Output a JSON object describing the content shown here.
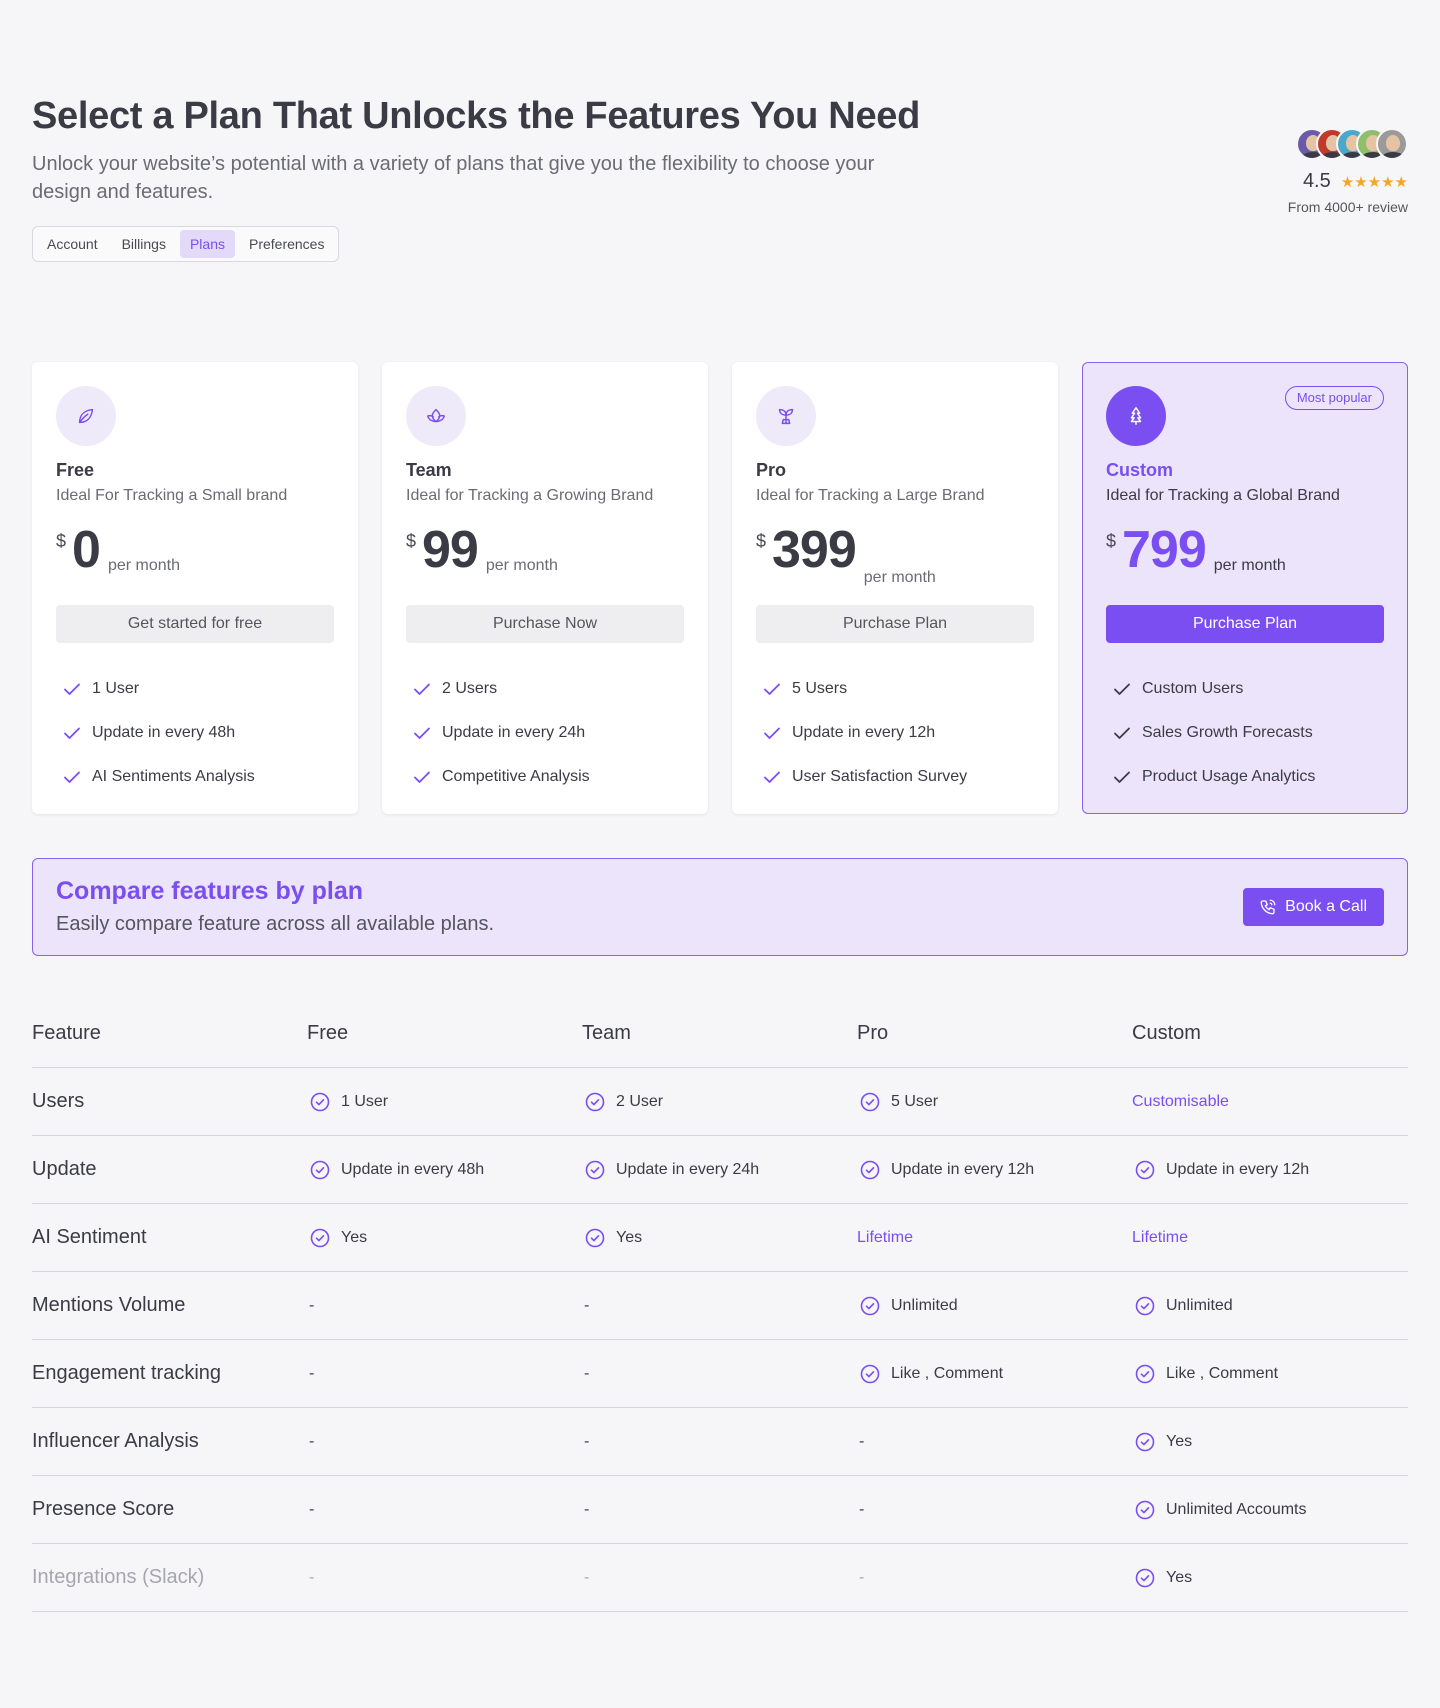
{
  "header": {
    "title": "Select a Plan That Unlocks the Features You Need",
    "subtitle": "Unlock your website’s potential with a variety of plans that give you the flexibility to choose your design and features.",
    "tabs": [
      {
        "label": "Account"
      },
      {
        "label": "Billings"
      },
      {
        "label": "Plans",
        "active": true
      },
      {
        "label": "Preferences"
      }
    ]
  },
  "rating": {
    "score": "4.5",
    "stars": "★★★★★",
    "reviews": "From 4000+ review",
    "avatar_colors": [
      "#6b5aa8",
      "#c0392b",
      "#4aa8c9",
      "#8fbf6a",
      "#9a9a9a"
    ]
  },
  "colors": {
    "accent": "#7a4ef0",
    "star": "#f5a623"
  },
  "plans": [
    {
      "icon": "leaf-icon",
      "name": "Free",
      "description": "Ideal For Tracking a Small brand",
      "currency": "$",
      "price": "0",
      "period": "per month",
      "cta": "Get started for free",
      "features": [
        "1 User",
        "Update in every 48h",
        "AI Sentiments Analysis"
      ]
    },
    {
      "icon": "lotus-icon",
      "name": "Team",
      "description": "Ideal for Tracking a Growing Brand",
      "currency": "$",
      "price": "99",
      "period": "per month",
      "cta": "Purchase Now",
      "features": [
        "2 Users",
        "Update in every 24h",
        "Competitive Analysis"
      ]
    },
    {
      "icon": "sprout-icon",
      "name": "Pro",
      "description": "Ideal for Tracking a Large Brand",
      "currency": "$",
      "price": "399",
      "period": "per month",
      "cta": "Purchase Plan",
      "features": [
        "5 Users",
        "Update in every 12h",
        "User Satisfaction Survey"
      ]
    },
    {
      "icon": "tree-icon",
      "name": "Custom",
      "description": "Ideal for Tracking a Global Brand",
      "currency": "$",
      "price": "799",
      "period": "per month",
      "cta": "Purchase Plan",
      "badge": "Most popular",
      "features": [
        "Custom Users",
        "Sales Growth Forecasts",
        "Product Usage Analytics"
      ]
    }
  ],
  "compare": {
    "title": "Compare features by plan",
    "subtitle": "Easily compare feature across all available plans.",
    "button": "Book a Call"
  },
  "table": {
    "headers": [
      "Feature",
      "Free",
      "Team",
      "Pro",
      "Custom"
    ],
    "rows": [
      {
        "feature": "Users",
        "cells": [
          {
            "t": "1 User",
            "c": true
          },
          {
            "t": "2 User",
            "c": true
          },
          {
            "t": "5 User",
            "c": true
          },
          {
            "t": "Customisable",
            "p": true
          }
        ]
      },
      {
        "feature": "Update",
        "cells": [
          {
            "t": "Update in every 48h",
            "c": true
          },
          {
            "t": "Update in every 24h",
            "c": true
          },
          {
            "t": "Update in every 12h",
            "c": true
          },
          {
            "t": "Update in every 12h",
            "c": true
          }
        ]
      },
      {
        "feature": "AI Sentiment",
        "cells": [
          {
            "t": "Yes",
            "c": true
          },
          {
            "t": "Yes",
            "c": true
          },
          {
            "t": "Lifetime",
            "p": true
          },
          {
            "t": "Lifetime",
            "p": true
          }
        ]
      },
      {
        "feature": "Mentions Volume",
        "cells": [
          {
            "t": "-"
          },
          {
            "t": "-"
          },
          {
            "t": "Unlimited",
            "c": true
          },
          {
            "t": "Unlimited",
            "c": true
          }
        ]
      },
      {
        "feature": "Engagement tracking",
        "cells": [
          {
            "t": "-"
          },
          {
            "t": "-"
          },
          {
            "t": "Like , Comment",
            "c": true
          },
          {
            "t": "Like , Comment",
            "c": true
          }
        ]
      },
      {
        "feature": "Influencer Analysis",
        "cells": [
          {
            "t": "-"
          },
          {
            "t": "-"
          },
          {
            "t": "-"
          },
          {
            "t": "Yes",
            "c": true
          }
        ]
      },
      {
        "feature": "Presence Score",
        "cells": [
          {
            "t": "-"
          },
          {
            "t": "-"
          },
          {
            "t": "-"
          },
          {
            "t": "Unlimited Accoumts",
            "c": true
          }
        ]
      },
      {
        "feature": "Integrations (Slack)",
        "faded": true,
        "cells": [
          {
            "t": "-"
          },
          {
            "t": "-"
          },
          {
            "t": "-"
          },
          {
            "t": "Yes",
            "c": true
          }
        ]
      }
    ]
  }
}
